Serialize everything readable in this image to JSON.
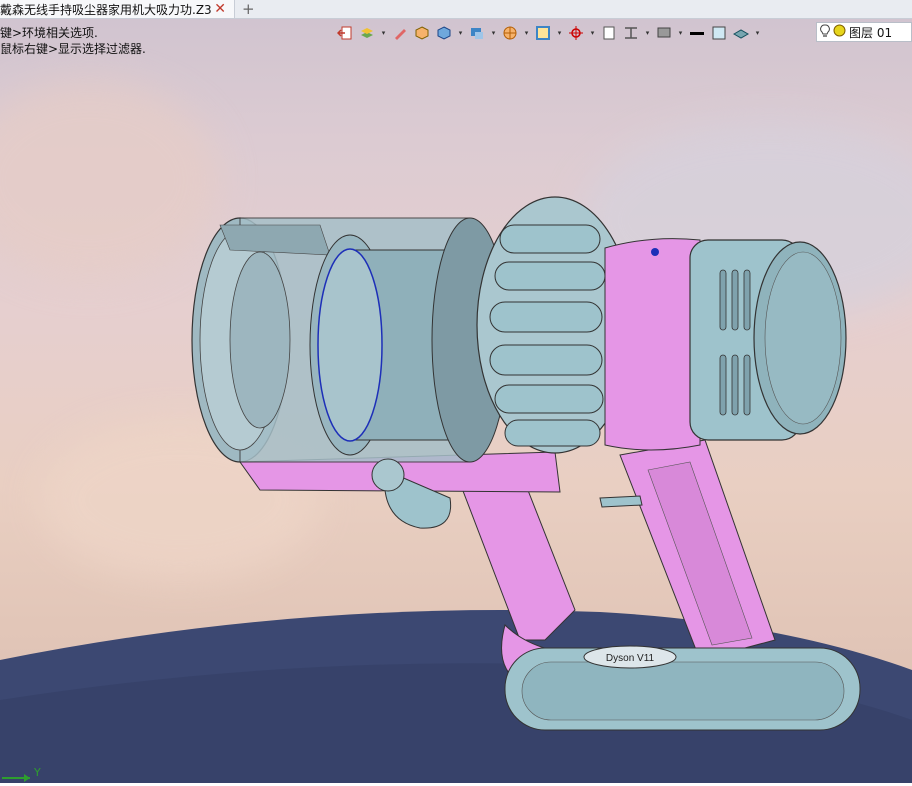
{
  "tab": {
    "title": "戴森无线手持吸尘器家用机大吸力功.Z3",
    "close_symbol": "✕",
    "add_symbol": "+"
  },
  "hints": {
    "line1": "键>环境相关选项.",
    "line2": "鼠标右键>显示选择过滤器."
  },
  "layer": {
    "name": "图层 01"
  },
  "axis": {
    "label": "Y"
  },
  "model": {
    "brand_marking": "Dyson V11"
  },
  "toolbar": {
    "icons": [
      "exit-icon",
      "layers-icon",
      "pencil-icon",
      "shaded-cube-icon",
      "blue-cube-icon",
      "display-mode-icon",
      "render-options-icon",
      "view-orient-icon",
      "snap-icon",
      "single-view-icon",
      "split-view-icon",
      "monitor-icon",
      "line-color-icon",
      "fill-color-icon",
      "plane-icon"
    ]
  },
  "colors": {
    "body_teal": "#9ec3cc",
    "accent_pink": "#e596e6",
    "base_navy": "#3c4872"
  }
}
